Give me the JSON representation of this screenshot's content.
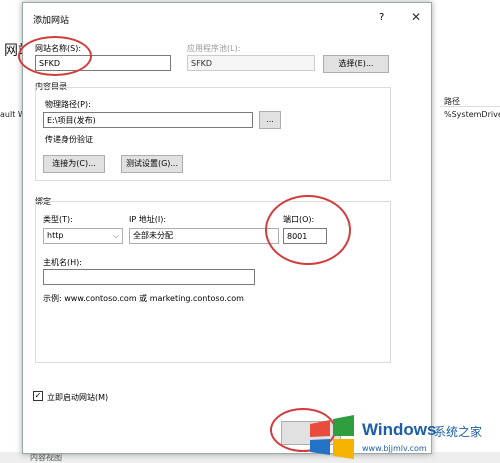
{
  "background": {
    "title": "网站",
    "left_row": "ault W",
    "right_header": "路径",
    "right_row": "%SystemDrive",
    "bottom_label": "内容视图"
  },
  "dialog": {
    "title": "添加网站",
    "help": "?",
    "close": "✕",
    "site_name_label": "网站名称(S):",
    "site_name_value": "SFKD",
    "app_pool_label": "应用程序池(L):",
    "app_pool_value": "SFKD",
    "select_button": "选择(E)...",
    "content_dir_label": "内容目录",
    "physical_path_label": "物理路径(P):",
    "physical_path_value": "E:\\项目(发布)",
    "browse_button": "...",
    "passthrough_label": "传递身份验证",
    "connect_as_button": "连接为(C)...",
    "test_settings_button": "测试设置(G)...",
    "binding_label": "绑定",
    "type_label": "类型(T):",
    "type_value": "http",
    "ip_label": "IP 地址(I):",
    "ip_value": "全部未分配",
    "port_label": "端口(O):",
    "port_value": "8001",
    "hostname_label": "主机名(H):",
    "hostname_value": "",
    "example_text": "示例: www.contoso.com 或 marketing.contoso.com",
    "autostart_label": "立即启动网站(M)",
    "autostart_checked": "✓"
  },
  "watermark": {
    "brand": "Windows",
    "brand_cn": "系统之家",
    "url": "www.bjjmlv.com"
  }
}
